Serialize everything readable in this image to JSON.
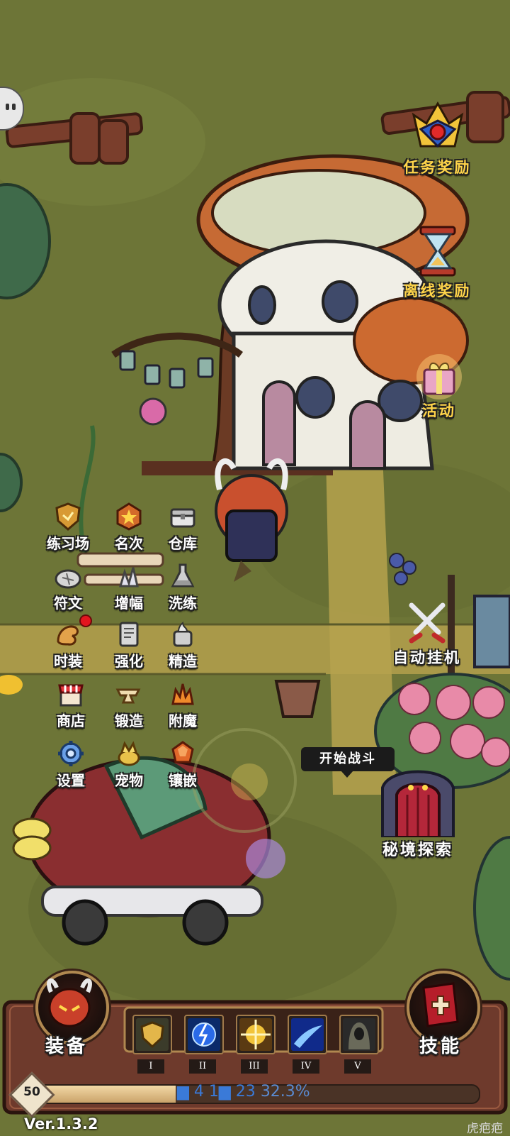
{
  "side_buttons": {
    "quest_reward": "任务奖励",
    "offline_reward": "离线奖励",
    "event": "活动",
    "auto_idle": "自动挂机",
    "secret_explore": "秘境探索"
  },
  "menu": {
    "training": "练习场",
    "ranking": "名次",
    "warehouse": "仓库",
    "rune": "符文",
    "amplify": "增幅",
    "reforge": "洗练",
    "fashion": "时装",
    "enhance": "强化",
    "refine": "精造",
    "shop": "商店",
    "forge": "锻造",
    "enchant": "附魔",
    "settings": "设置",
    "pet": "宠物",
    "inlay": "镶嵌"
  },
  "start_battle": "开始战斗",
  "bottom_bar": {
    "equipment": "装备",
    "skills": "技能",
    "skill_slots": [
      "I",
      "II",
      "III",
      "IV",
      "V"
    ],
    "skill_icons": [
      "shield-skill-icon",
      "lightning-orb-skill-icon",
      "golden-burst-skill-icon",
      "blue-slash-skill-icon",
      "hooded-figure-skill-icon"
    ],
    "level": "50",
    "progress_text": "32.3%",
    "progress_fraction": 0.323
  },
  "version": "Ver.1.3.2",
  "watermark": "虎疤疤",
  "colors": {
    "label_gold": "#ffd54a",
    "panel": "#6e3a2c",
    "grass": "#6b7335",
    "path": "#b7a049"
  }
}
